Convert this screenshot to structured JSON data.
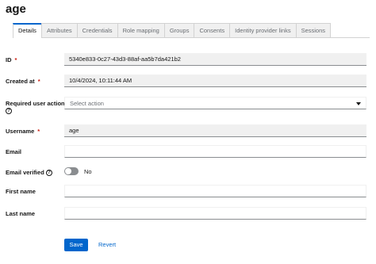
{
  "page": {
    "title": "age"
  },
  "tabs": [
    {
      "label": "Details"
    },
    {
      "label": "Attributes"
    },
    {
      "label": "Credentials"
    },
    {
      "label": "Role mapping"
    },
    {
      "label": "Groups"
    },
    {
      "label": "Consents"
    },
    {
      "label": "Identity provider links"
    },
    {
      "label": "Sessions"
    }
  ],
  "active_tab": "Details",
  "form": {
    "id": {
      "label": "ID",
      "required": "*",
      "value": "5340e833-0c27-43d3-88af-aa5b7da421b2"
    },
    "created_at": {
      "label": "Created at",
      "required": "*",
      "value": "10/4/2024, 10:11:44 AM"
    },
    "required_actions": {
      "label": "Required user actions",
      "placeholder": "Select action"
    },
    "username": {
      "label": "Username",
      "required": "*",
      "value": "age"
    },
    "email": {
      "label": "Email",
      "value": ""
    },
    "email_verified": {
      "label": "Email verified",
      "state_label": "No",
      "on": false
    },
    "first_name": {
      "label": "First name",
      "value": ""
    },
    "last_name": {
      "label": "Last name",
      "value": ""
    }
  },
  "actions": {
    "save_label": "Save",
    "revert_label": "Revert"
  },
  "colors": {
    "primary": "#0066cc",
    "required": "#c9190b",
    "readonly_bg": "#f0f0f0"
  }
}
